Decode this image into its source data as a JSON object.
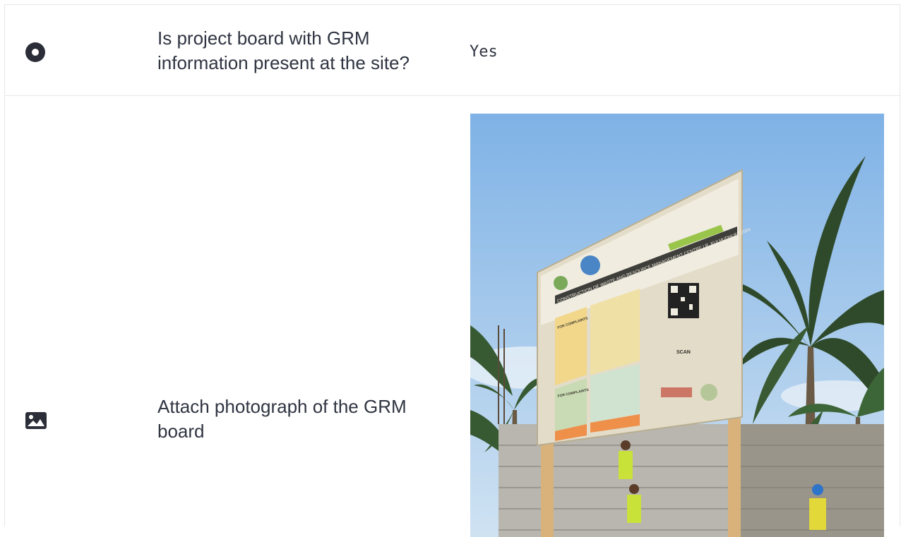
{
  "rows": [
    {
      "icon": "radio-icon",
      "question": "Is project board with GRM information present at the site?",
      "answer": "Yes"
    },
    {
      "icon": "image-icon",
      "question": "Attach photograph of the GRM board"
    }
  ],
  "photo": {
    "board_heading": "CONSTRUCTION OF WASTE AND RESOURCE MANAGEMENT CENTRE | R. KULHUDHUFFUSHI",
    "complaints_label_1": "FOR COMPLAINTS",
    "complaints_label_2": "FOR COMPLAINTS",
    "scan_label": "SCAN"
  }
}
